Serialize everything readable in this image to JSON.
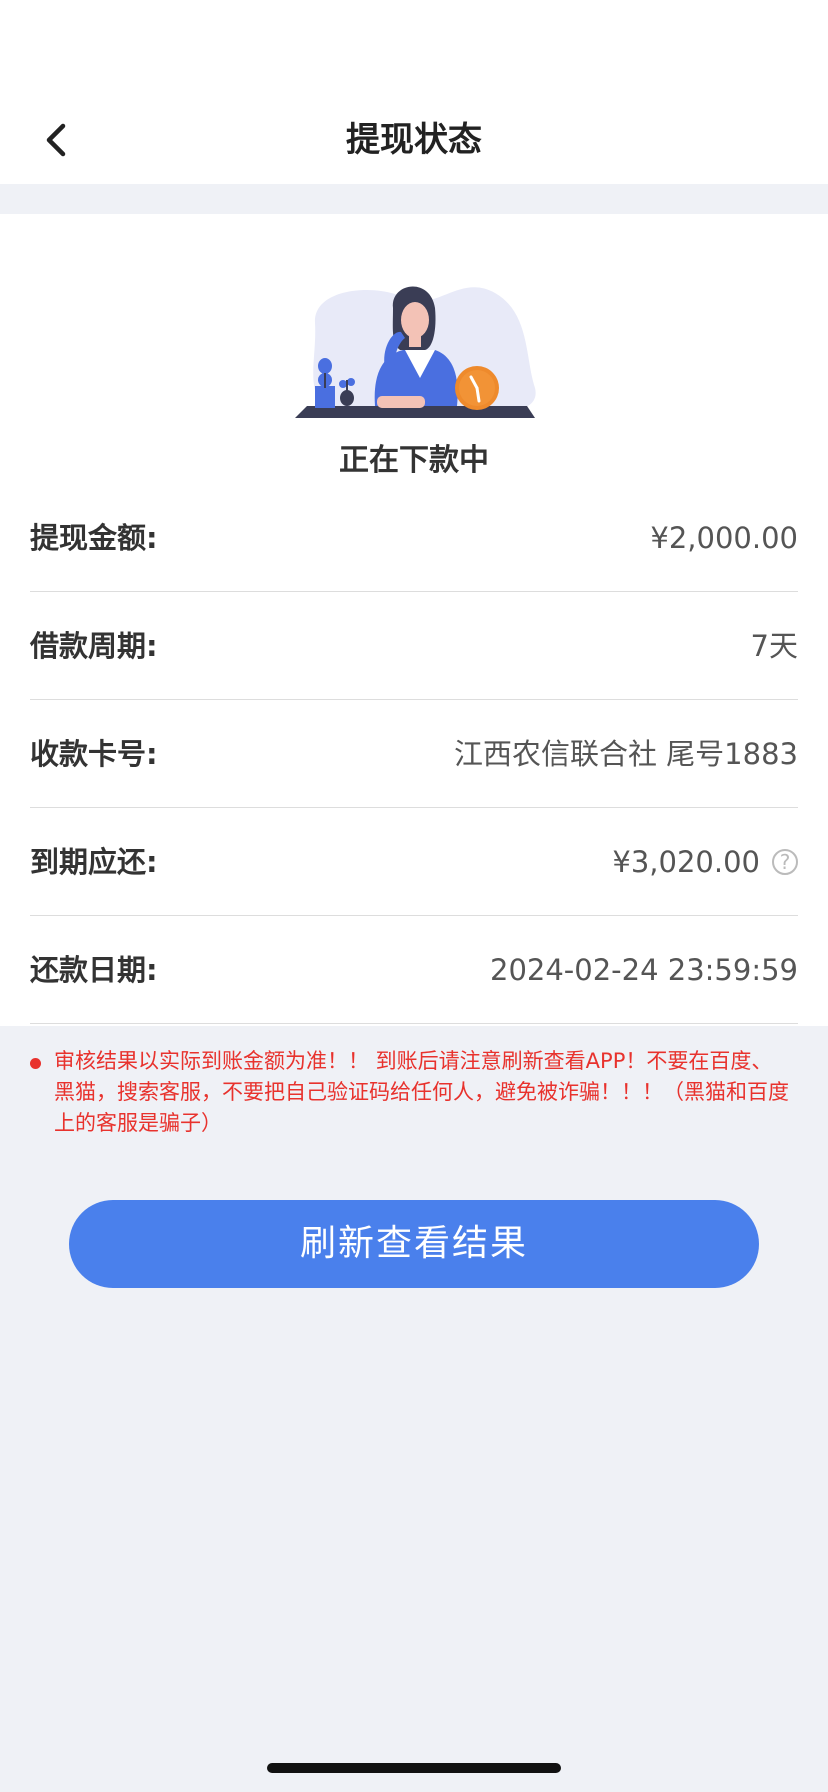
{
  "header": {
    "title": "提现状态",
    "back_icon": "chevron-left-icon"
  },
  "status": {
    "text": "正在下款中",
    "illustration": "woman-waiting-clock-illustration"
  },
  "details": [
    {
      "label": "提现金额:",
      "value": "¥2,000.00"
    },
    {
      "label": "借款周期:",
      "value": "7天"
    },
    {
      "label": "收款卡号:",
      "value": "江西农信联合社 尾号1883"
    },
    {
      "label": "到期应还:",
      "value": "¥3,020.00",
      "help_icon": "?"
    },
    {
      "label": "还款日期:",
      "value": "2024-02-24 23:59:59"
    }
  ],
  "notice": {
    "text": "审核结果以实际到账金额为准！！ 到账后请注意刷新查看APP！不要在百度、黑猫，搜索客服，不要把自己验证码给任何人，避免被诈骗！！！（黑猫和百度上的客服是骗子）"
  },
  "actions": {
    "refresh_label": "刷新查看结果"
  },
  "colors": {
    "accent": "#4a80ec",
    "warning": "#e8322d",
    "background": "#eff1f6"
  }
}
